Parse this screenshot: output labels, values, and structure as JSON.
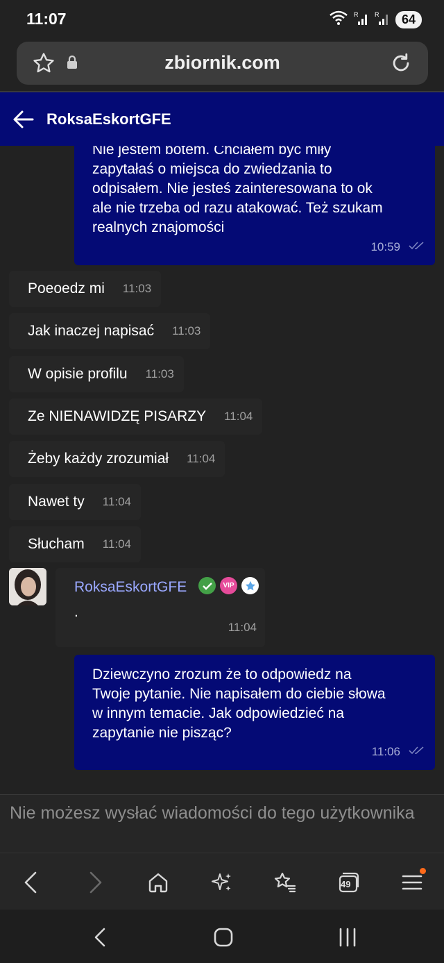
{
  "status_bar": {
    "time": "11:07",
    "battery": "64"
  },
  "browser": {
    "url": "zbiornik.com"
  },
  "chat": {
    "title": "RoksaEskortGFE",
    "messages_top_out": {
      "lines": [
        "Nie jestem botem. Chciałem być miły",
        "zapytałaś o miejsca do zwiedzania to",
        "odpisałem. Nie jesteś zainteresowana to ok",
        "ale nie trzeba od razu atakować. Też szukam",
        "realnych znajomości"
      ],
      "time": "10:59"
    },
    "incoming": [
      {
        "text": "Poeoedz mi",
        "time": "11:03"
      },
      {
        "text": "Jak inaczej napisać",
        "time": "11:03"
      },
      {
        "text": "W opisie profilu",
        "time": "11:03"
      },
      {
        "text": "Ze NIENAWIDZĘ PISARZY",
        "time": "11:04"
      },
      {
        "text": "Żeby każdy zrozumiał",
        "time": "11:04"
      },
      {
        "text": "Nawet ty",
        "time": "11:04"
      },
      {
        "text": "Słucham",
        "time": "11:04"
      }
    ],
    "card": {
      "name": "RoksaEskortGFE",
      "body": ".",
      "time": "11:04",
      "badge_vip": "VIP"
    },
    "messages_bottom_out": {
      "lines": [
        "Dziewczyno zrozum że to odpowiedz na",
        "Twoje pytanie. Nie napisałem do ciebie słowa",
        "w innym temacie. Jak odpowiedzieć na",
        "zapytanie nie pisząc?"
      ],
      "time": "11:06"
    },
    "notice": "Nie możesz wysłać wiadomości do tego użytkownika"
  },
  "toolbar": {
    "tabs_count": "49"
  },
  "colors": {
    "header_bg": "#040a75",
    "outgoing_bg": "#040a75",
    "incoming_bg": "#262626",
    "notification_dot": "#ff6a1a"
  }
}
